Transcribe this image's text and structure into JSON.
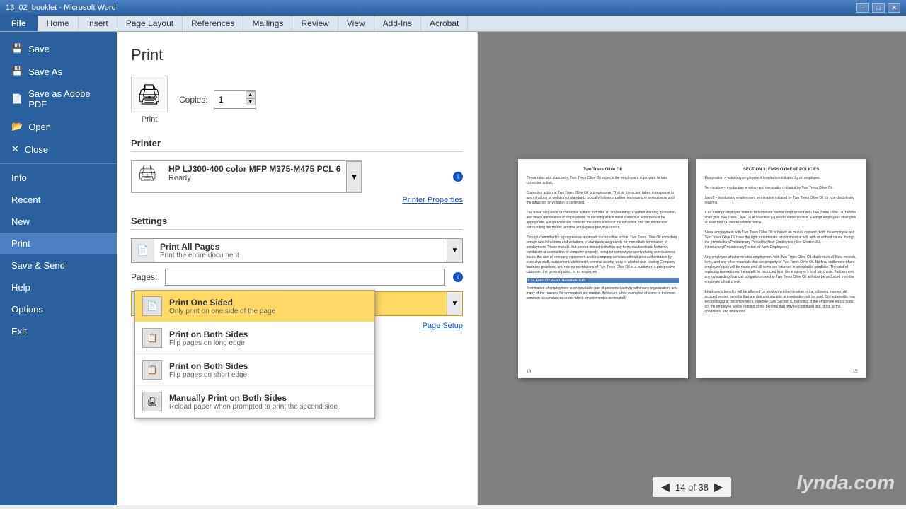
{
  "titleBar": {
    "title": "13_02_booklet - Microsoft Word",
    "controls": [
      "minimize",
      "maximize",
      "close"
    ]
  },
  "ribbon": {
    "tabs": [
      {
        "label": "File",
        "active": true,
        "isFile": true
      },
      {
        "label": "Home"
      },
      {
        "label": "Insert"
      },
      {
        "label": "Page Layout"
      },
      {
        "label": "References"
      },
      {
        "label": "Mailings"
      },
      {
        "label": "Review"
      },
      {
        "label": "View"
      },
      {
        "label": "Add-Ins"
      },
      {
        "label": "Acrobat"
      }
    ]
  },
  "sidebar": {
    "items": [
      {
        "label": "Save",
        "icon": "💾"
      },
      {
        "label": "Save As",
        "icon": "💾"
      },
      {
        "label": "Save as Adobe PDF",
        "icon": "📄"
      },
      {
        "label": "Open",
        "icon": "📂"
      },
      {
        "label": "Close",
        "icon": "✕"
      },
      {
        "label": "Info",
        "active": false
      },
      {
        "label": "Recent",
        "active": false
      },
      {
        "label": "New",
        "active": false
      },
      {
        "label": "Print",
        "active": true
      },
      {
        "label": "Save & Send"
      },
      {
        "label": "Help"
      },
      {
        "label": "Options"
      },
      {
        "label": "Exit"
      }
    ]
  },
  "print": {
    "title": "Print",
    "copiesLabel": "Copies:",
    "copiesValue": "1",
    "printer": {
      "sectionLabel": "Printer",
      "name": "HP LJ300-400 color MFP M375-M475 PCL 6",
      "status": "Ready",
      "propertiesLink": "Printer Properties"
    },
    "settings": {
      "sectionLabel": "Settings",
      "printRange": {
        "mainText": "Print All Pages",
        "subText": "Print the entire document"
      },
      "pages": {
        "label": "Pages:",
        "placeholder": ""
      },
      "printSides": {
        "mainText": "Print One Sided",
        "subText": "Only print on one side of the page"
      }
    },
    "pageSetupLink": "Page Setup"
  },
  "dropdown": {
    "options": [
      {
        "title": "Print One Sided",
        "desc": "Only print on one side of the page",
        "selected": true
      },
      {
        "title": "Print on Both Sides",
        "desc": "Flip pages on long edge",
        "selected": false
      },
      {
        "title": "Print on Both Sides",
        "desc": "Flip pages on short edge",
        "selected": false
      },
      {
        "title": "Manually Print on Both Sides",
        "desc": "Reload paper when prompted to print the second side",
        "selected": false
      }
    ]
  },
  "preview": {
    "currentPage": "14",
    "totalPages": "38",
    "pages": [
      {
        "title": "Two Trees Olive Oil",
        "number": "14",
        "side": "left",
        "highlight": "3:14 EMPLOYMENT TERMINATION"
      },
      {
        "title": "SECTION 3: EMPLOYMENT POLICIES",
        "number": "15",
        "side": "right"
      }
    ]
  },
  "watermark": "lynda.com"
}
